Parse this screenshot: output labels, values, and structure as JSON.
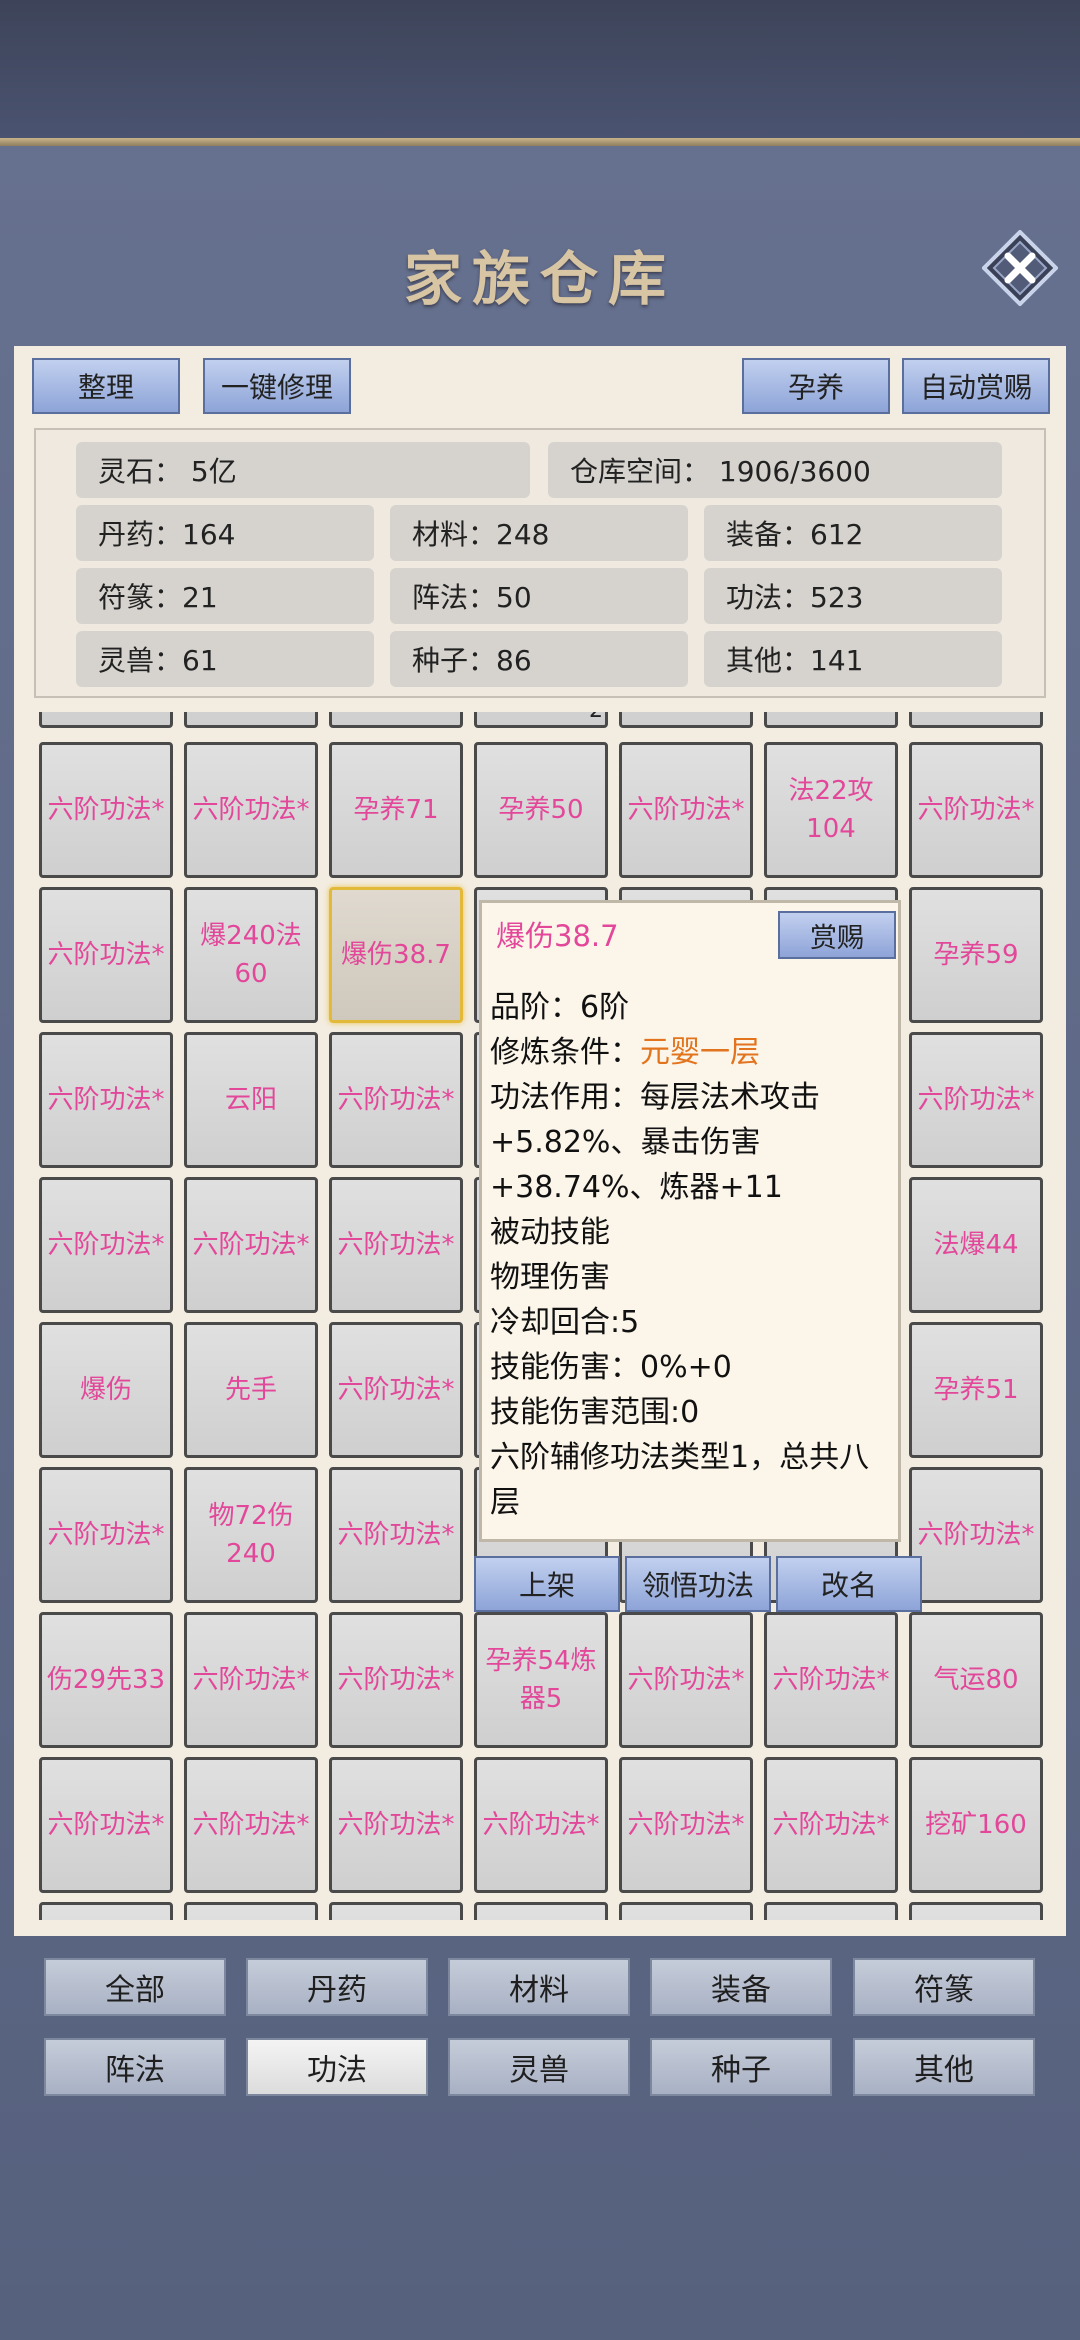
{
  "title": "家族仓库",
  "toolbar": {
    "sort": "整理",
    "repair": "一键修理",
    "nurture": "孕养",
    "auto_reward": "自动赏赐"
  },
  "stats": {
    "spirit_stone": "灵石：  5亿",
    "capacity": "仓库空间：    1906/3600",
    "pills": "丹药：164",
    "materials": "材料：248",
    "equipment": "装备：612",
    "talismans": "符篆：21",
    "formations": "阵法：50",
    "techniques": "功法：523",
    "beasts": "灵兽：61",
    "seeds": "种子：86",
    "others": "其他：141"
  },
  "grid": {
    "row1": [
      "六阶功法*",
      "六阶功法*",
      "孕养71",
      "孕养50",
      "六阶功法*",
      "法22攻104",
      "六阶功法*"
    ],
    "row2": [
      "六阶功法*",
      "爆240法60",
      "爆伤38.7",
      "",
      "",
      "",
      "孕养59"
    ],
    "row3": [
      "六阶功法*",
      "云阳",
      "六阶功法*",
      "",
      "",
      "",
      "六阶功法*"
    ],
    "row4": [
      "六阶功法*",
      "六阶功法*",
      "六阶功法*",
      "",
      "",
      "",
      "法爆44"
    ],
    "row5": [
      "爆伤",
      "先手",
      "六阶功法*",
      "",
      "",
      "",
      "孕养51"
    ],
    "row6": [
      "六阶功法*",
      "物72伤240",
      "六阶功法*",
      "",
      "",
      "",
      "六阶功法*"
    ],
    "row7": [
      "伤29先33",
      "六阶功法*",
      "六阶功法*",
      "孕养54炼器5",
      "六阶功法*",
      "六阶功法*",
      "气运80"
    ],
    "row8": [
      "六阶功法*",
      "六阶功法*",
      "六阶功法*",
      "六阶功法*",
      "六阶功法*",
      "六阶功法*",
      "挖矿160"
    ],
    "top_partial_count": "2"
  },
  "popup": {
    "name": "爆伤38.7",
    "reward_btn": "赏赐",
    "grade": "品阶：6阶",
    "req_label": "修炼条件：",
    "req_value": "元婴一层",
    "effect": "功法作用：每层法术攻击+5.82%、暴击伤害+38.74%、炼器+11",
    "passive": "被动技能",
    "damage_type": "物理伤害",
    "cooldown": "冷却回合:5",
    "skill_dmg": "技能伤害：0%+0",
    "skill_range": "技能伤害范围:0",
    "desc": "六阶辅修功法类型1，总共八层"
  },
  "actions": {
    "shelve": "上架",
    "comprehend": "领悟功法",
    "rename": "改名"
  },
  "filters": [
    "全部",
    "丹药",
    "材料",
    "装备",
    "符篆",
    "阵法",
    "功法",
    "灵兽",
    "种子",
    "其他"
  ],
  "active_filter": "功法"
}
